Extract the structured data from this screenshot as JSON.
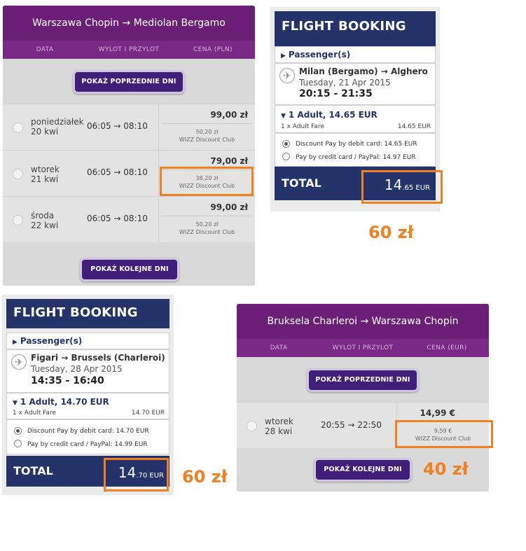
{
  "panel1": {
    "title": "Warszawa Chopin → Mediolan Bergamo",
    "col_data": "DATA",
    "col_flight": "WYLOT I PRZYLOT",
    "col_price": "CENA (PLN)",
    "prev_label": "POKAŻ POPRZEDNIE DNI",
    "next_label": "POKAŻ KOLEJNE DNI",
    "rows": [
      {
        "day": "poniedziałek",
        "date": "20 kwi",
        "time": "06:05 → 08:10",
        "price": "99,00 zł",
        "disc_price": "50,20 zł",
        "club": "WIZZ Discount Club"
      },
      {
        "day": "wtorek",
        "date": "21 kwi",
        "time": "06:05 → 08:10",
        "price": "79,00 zł",
        "disc_price": "38,20 zł",
        "club": "WIZZ Discount Club"
      },
      {
        "day": "środa",
        "date": "22 kwi",
        "time": "06:05 → 08:10",
        "price": "99,00 zł",
        "disc_price": "50,20 zł",
        "club": "WIZZ Discount Club"
      }
    ]
  },
  "booking1": {
    "title": "FLIGHT BOOKING",
    "passengers": "Passenger(s)",
    "route": "Milan (Bergamo) → Alghero",
    "date": "Tuesday, 21 Apr 2015",
    "times": "20:15 - 21:35",
    "adult": "1 Adult, 14.65 EUR",
    "fare_label": "1 x Adult Fare",
    "fare_value": "14.65 EUR",
    "pay_debit": "Discount Pay by debit card: 14.65 EUR",
    "pay_credit": "Pay by credit card / PayPal: 14.97 EUR",
    "total_label": "TOTAL",
    "total_int": "14",
    "total_dec": ".65 EUR",
    "note": "60 zł"
  },
  "booking2": {
    "title": "FLIGHT BOOKING",
    "passengers": "Passenger(s)",
    "route": "Figari → Brussels (Charleroi)",
    "date": "Tuesday, 28 Apr 2015",
    "times": "14:35 - 16:40",
    "adult": "1 Adult, 14.70 EUR",
    "fare_label": "1 x Adult Fare",
    "fare_value": "14.70 EUR",
    "pay_debit": "Discount Pay by debit card: 14.70 EUR",
    "pay_credit": "Pay by credit card / PayPal: 14.99 EUR",
    "total_label": "TOTAL",
    "total_int": "14",
    "total_dec": ".70 EUR",
    "note": "60 zł"
  },
  "panel2": {
    "title": "Bruksela Charleroi → Warszawa Chopin",
    "col_data": "DATA",
    "col_flight": "WYLOT I PRZYLOT",
    "col_price": "CENA (EUR)",
    "prev_label": "POKAŻ POPRZEDNIE DNI",
    "next_label": "POKAŻ KOLEJNE DNI",
    "rows": [
      {
        "day": "wtorek",
        "date": "28 kwi",
        "time": "20:55 → 22:50",
        "price": "14,99 €",
        "disc_price": "9,59 €",
        "club": "WIZZ Discount Club"
      }
    ],
    "note": "40 zł"
  },
  "colors": {
    "wizz_purple": "#6b1f77",
    "button_purple": "#3f1f7a",
    "booking_navy": "#24346a",
    "highlight_orange": "#f08020"
  }
}
